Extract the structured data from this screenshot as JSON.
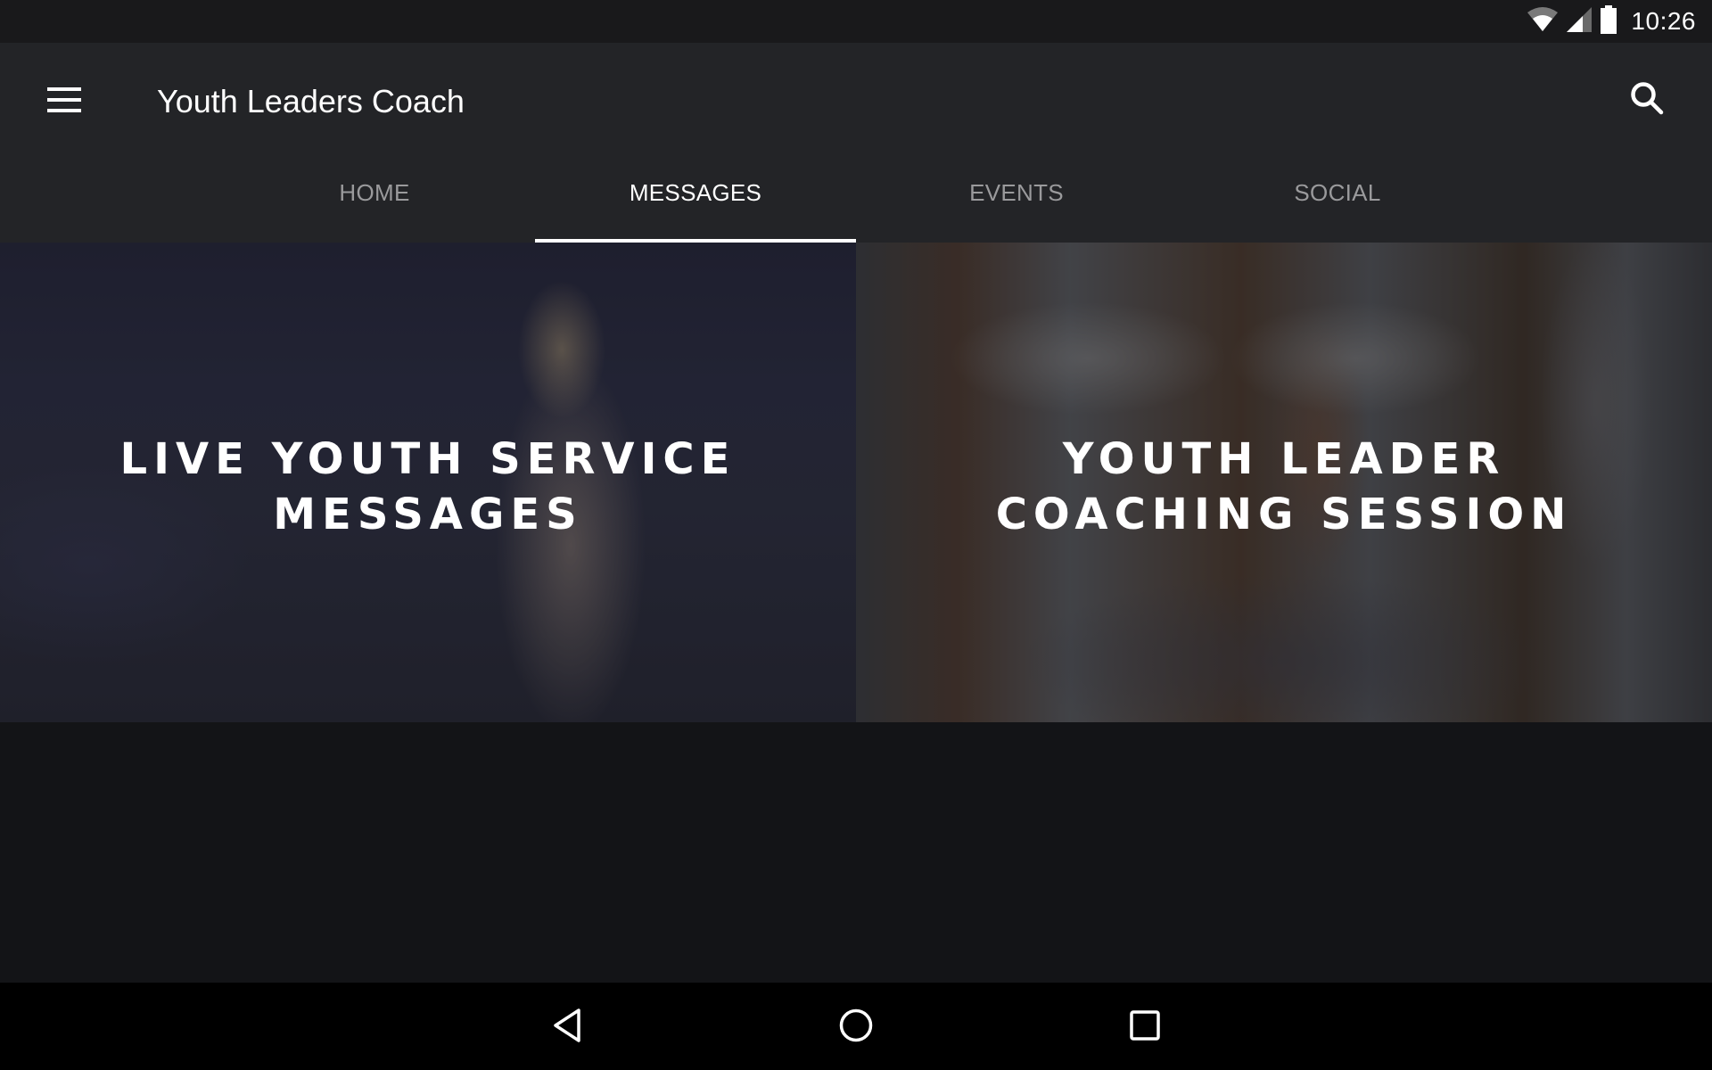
{
  "status_bar": {
    "time": "10:26",
    "icons": [
      "wifi-icon",
      "cell-signal-icon",
      "battery-icon"
    ]
  },
  "app_bar": {
    "title": "Youth Leaders Coach",
    "menu_icon": "hamburger-menu-icon",
    "search_icon": "search-icon"
  },
  "tabs": [
    {
      "label": "HOME",
      "active": false
    },
    {
      "label": "MESSAGES",
      "active": true
    },
    {
      "label": "EVENTS",
      "active": false
    },
    {
      "label": "SOCIAL",
      "active": false
    }
  ],
  "tiles": [
    {
      "title_line1": "LIVE YOUTH SERVICE",
      "title_line2": "MESSAGES"
    },
    {
      "title_line1": "YOUTH LEADER",
      "title_line2": "COACHING SESSION"
    }
  ],
  "nav_bar": {
    "back": "back-icon",
    "home": "home-icon",
    "recents": "recents-icon"
  },
  "colors": {
    "status_bar": "#19191b",
    "app_bar": "#232427",
    "background": "#131417",
    "tab_active": "#ffffff",
    "tab_inactive": "#9a9a9c",
    "indicator": "#ffffff"
  }
}
